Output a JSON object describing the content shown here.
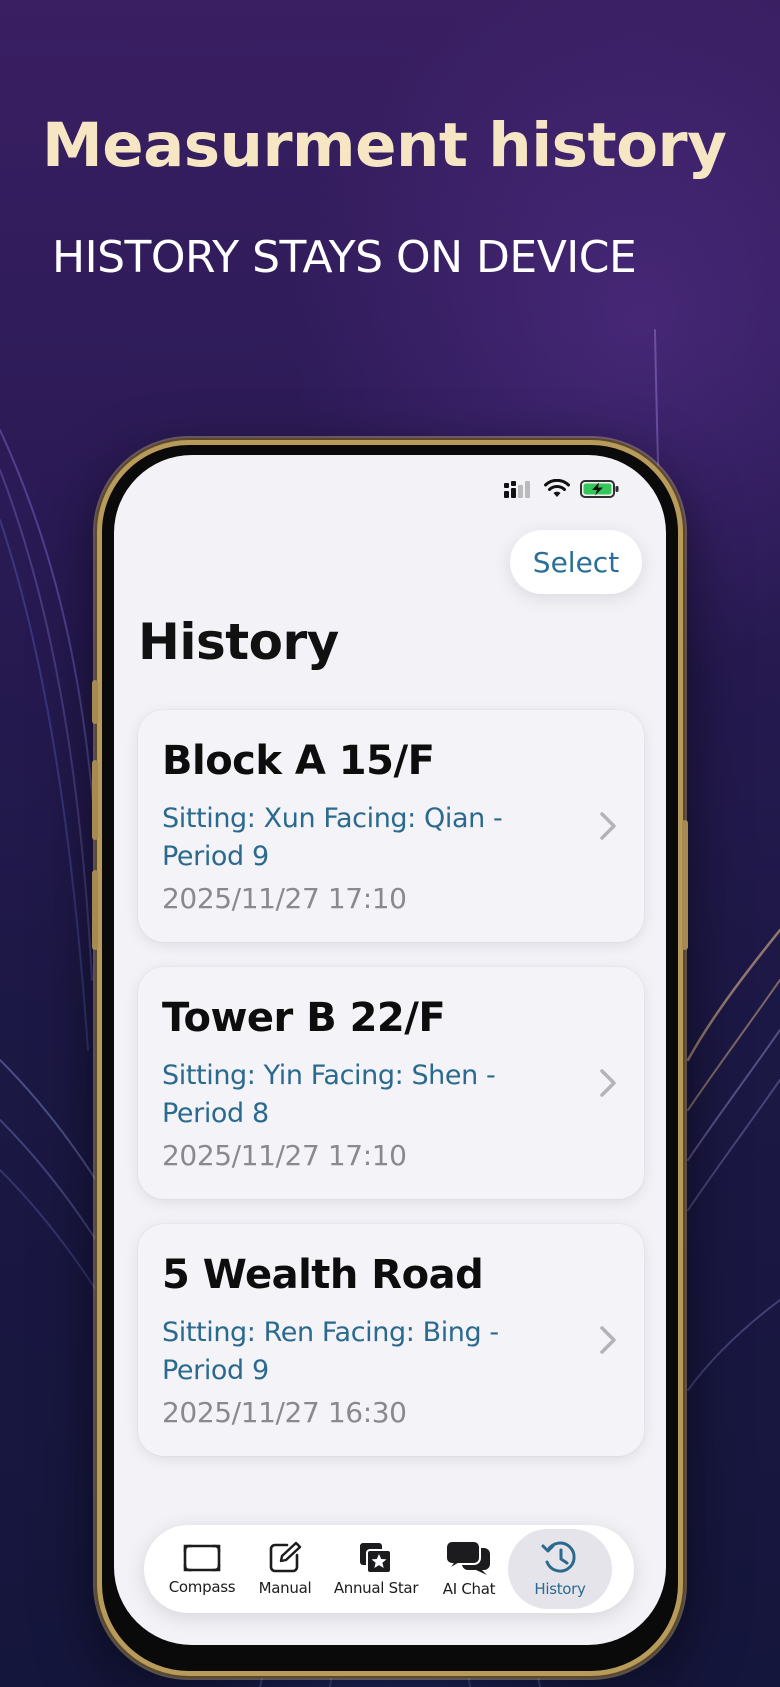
{
  "promo": {
    "title": "Measurment history",
    "subtitle": "HISTORY STAYS ON DEVICE"
  },
  "header": {
    "select_label": "Select",
    "title": "History"
  },
  "history": [
    {
      "name": "Block A 15/F",
      "detail": "Sitting: Xun Facing: Qian - Period 9",
      "date": "2025/11/27 17:10"
    },
    {
      "name": "Tower B 22/F",
      "detail": "Sitting: Yin Facing: Shen - Period 8",
      "date": "2025/11/27 17:10"
    },
    {
      "name": "5 Wealth Road",
      "detail": "Sitting: Ren Facing: Bing - Period 9",
      "date": "2025/11/27 16:30"
    }
  ],
  "tabs": [
    {
      "label": "Compass",
      "icon": "compass-icon",
      "active": false
    },
    {
      "label": "Manual",
      "icon": "edit-icon",
      "active": false
    },
    {
      "label": "Annual Star",
      "icon": "annual-star-icon",
      "active": false
    },
    {
      "label": "AI Chat",
      "icon": "chat-icon",
      "active": false
    },
    {
      "label": "History",
      "icon": "history-icon",
      "active": true
    }
  ],
  "colors": {
    "accent": "#2b6a8e",
    "title_gold": "#f6e6c4",
    "battery_green": "#34c759"
  }
}
